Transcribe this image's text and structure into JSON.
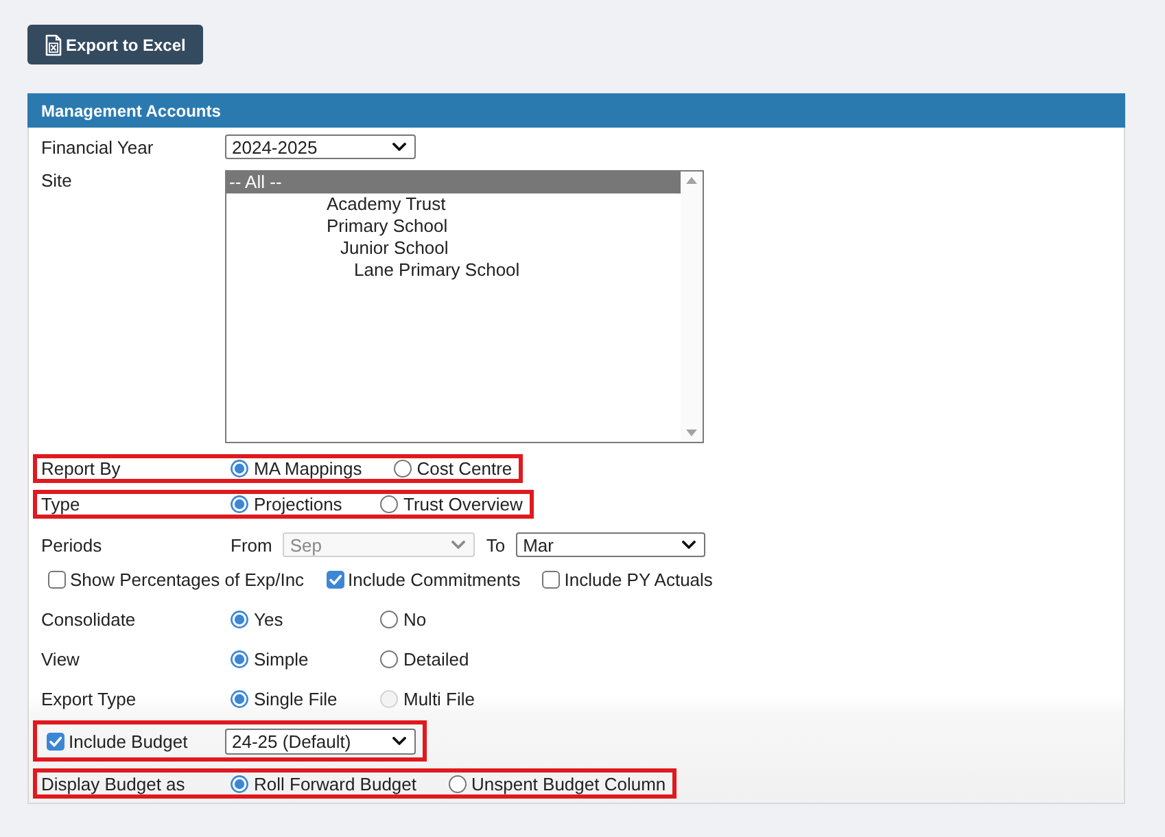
{
  "toolbar": {
    "export_button": {
      "label": "Export to Excel"
    }
  },
  "panel": {
    "title": "Management Accounts",
    "rows": [
      {
        "kind": "select",
        "label": "Financial Year",
        "value": "2024-2025"
      },
      {
        "kind": "listbox",
        "label": "Site",
        "items": [
          {
            "label": "-- All --",
            "selected": true,
            "children": [
              {
                "label": "Academy Trust",
                "selected": false
              },
              {
                "label": "Primary School",
                "selected": false,
                "children": [
                  {
                    "label": "Junior School",
                    "selected": false,
                    "children": [
                      {
                        "label": "Lane Primary School",
                        "selected": false
                      }
                    ]
                  }
                ]
              }
            ]
          }
        ]
      },
      {
        "kind": "radio",
        "label": "Report By",
        "highlighted": true,
        "options": [
          {
            "label": "MA Mappings",
            "selected": true,
            "disabled": false
          },
          {
            "label": "Cost Centre",
            "selected": false,
            "disabled": false
          }
        ]
      },
      {
        "kind": "radio",
        "label": "Type",
        "highlighted": true,
        "options": [
          {
            "label": "Projections",
            "selected": true,
            "disabled": false
          },
          {
            "label": "Trust Overview",
            "selected": false,
            "disabled": false
          }
        ]
      },
      {
        "kind": "period",
        "label": "Periods",
        "from": {
          "label": "From",
          "value": "Sep",
          "disabled": true
        },
        "to": {
          "label": "To",
          "value": "Mar",
          "disabled": false
        }
      },
      {
        "kind": "checkboxes",
        "options": [
          {
            "label": "Show Percentages of Exp/Inc",
            "checked": false
          },
          {
            "label": "Include Commitments",
            "checked": true
          },
          {
            "label": "Include PY Actuals",
            "checked": false
          }
        ]
      },
      {
        "kind": "radio",
        "label": "Consolidate",
        "options": [
          {
            "label": "Yes",
            "selected": true,
            "disabled": false
          },
          {
            "label": "No",
            "selected": false,
            "disabled": false
          }
        ]
      },
      {
        "kind": "radio",
        "label": "View",
        "options": [
          {
            "label": "Simple",
            "selected": true,
            "disabled": false
          },
          {
            "label": "Detailed",
            "selected": false,
            "disabled": false
          }
        ]
      },
      {
        "kind": "radio",
        "label": "Export Type",
        "options": [
          {
            "label": "Single File",
            "selected": true,
            "disabled": false
          },
          {
            "label": "Multi File",
            "selected": false,
            "disabled": true
          }
        ]
      },
      {
        "kind": "check_select",
        "label": "Include Budget",
        "checked": true,
        "value": "24-25 (Default)",
        "highlighted": true
      },
      {
        "kind": "radio",
        "label": "Display Budget as",
        "highlighted": true,
        "options": [
          {
            "label": "Roll Forward Budget",
            "selected": true,
            "disabled": false
          },
          {
            "label": "Unspent Budget Column",
            "selected": false,
            "disabled": false
          }
        ]
      }
    ]
  }
}
